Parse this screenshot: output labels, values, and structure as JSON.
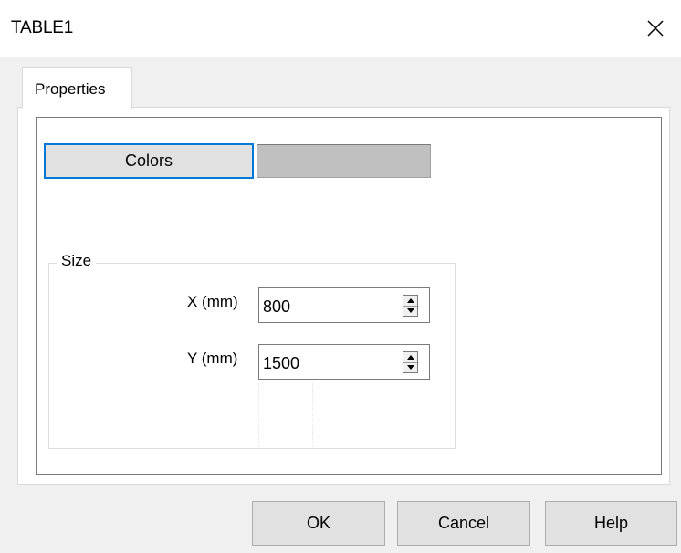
{
  "window": {
    "title": "TABLE1"
  },
  "tabs": [
    {
      "label": "Properties",
      "selected": true
    }
  ],
  "properties": {
    "colors_button_label": "Colors",
    "color_swatch_value": "#c0c0c0",
    "size_group": {
      "legend": "Size",
      "x_label": "X (mm)",
      "x_value": "800",
      "y_label": "Y (mm)",
      "y_value": "1500"
    }
  },
  "buttons": {
    "ok": "OK",
    "cancel": "Cancel",
    "help": "Help"
  },
  "icons": {
    "close": "close-icon",
    "spin_up": "chevron-up-icon",
    "spin_down": "chevron-down-icon"
  },
  "colors": {
    "focus_border": "#0078d7",
    "button_face": "#e1e1e1",
    "swatch": "#c0c0c0",
    "dialog_bg": "#f0f0f0"
  }
}
